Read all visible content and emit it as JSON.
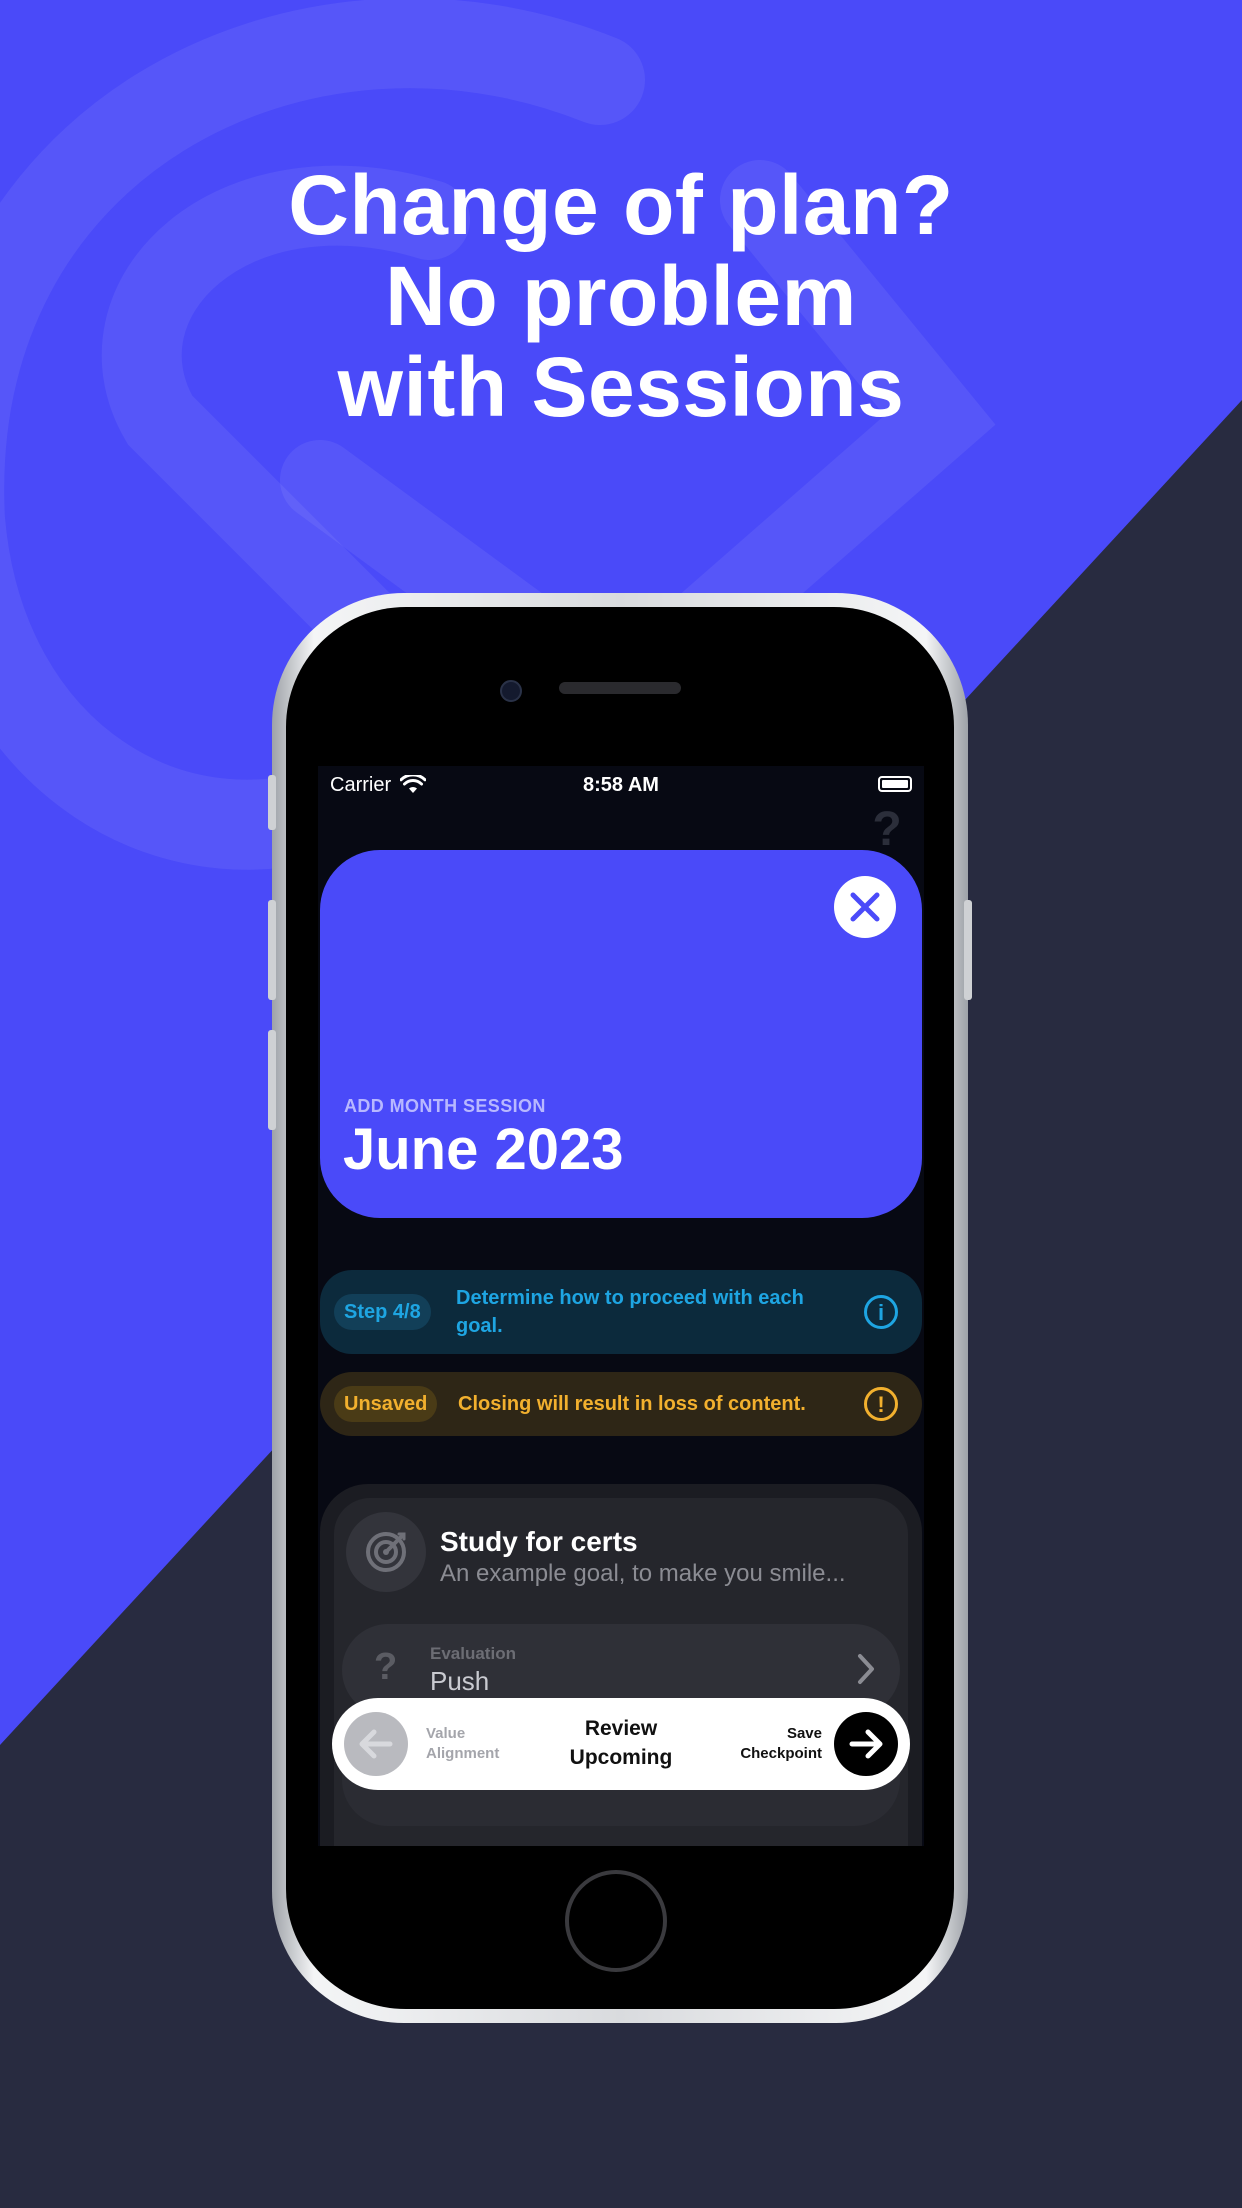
{
  "promo": {
    "headline_lines": [
      "Change of plan?",
      "No problem",
      "with Sessions"
    ],
    "background_color": "#4a4af9",
    "secondary_background_color": "#282b40"
  },
  "status_bar": {
    "carrier": "Carrier",
    "time": "8:58 AM",
    "wifi_icon": "wifi-icon",
    "battery_icon": "battery-icon"
  },
  "header": {
    "help_icon": "question-icon",
    "close_icon": "close-icon",
    "subtitle": "ADD MONTH SESSION",
    "title": "June 2023"
  },
  "step_banner": {
    "badge": "Step 4/8",
    "text": "Determine how to proceed with each goal.",
    "icon": "info-icon",
    "color": "#1ea5e2"
  },
  "unsaved_banner": {
    "badge": "Unsaved",
    "text": "Closing will result in loss of content.",
    "icon": "warning-icon",
    "color": "#f2b02e"
  },
  "goal": {
    "icon": "target-icon",
    "title": "Study for certs",
    "description": "An example goal, to make you smile...",
    "evaluation_label": "Evaluation",
    "evaluation_value": "Push",
    "evaluation_icon": "question-icon"
  },
  "bottom_nav": {
    "back_icon": "arrow-left-icon",
    "prev_label_lines": [
      "Value",
      "Alignment"
    ],
    "current_label_lines": [
      "Review",
      "Upcoming"
    ],
    "next_label_lines": [
      "Save",
      "Checkpoint"
    ],
    "forward_icon": "arrow-right-icon"
  }
}
